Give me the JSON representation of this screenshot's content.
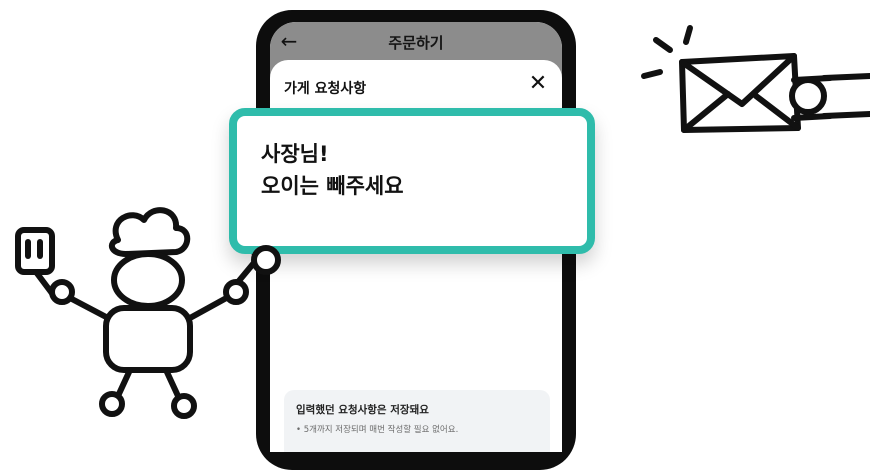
{
  "app_bar": {
    "back_icon": "arrow-left-icon",
    "title": "주문하기"
  },
  "sheet": {
    "title": "가게 요청사항",
    "close_icon": "close-icon"
  },
  "request": {
    "line1": "사장님!",
    "line2": "오이는 빼주세요"
  },
  "notice": {
    "title": "입력했던 요청사항은 저장돼요",
    "item": "• 5개까지 저장되며 매번 작성할 필요 없어요."
  },
  "colors": {
    "accent": "#2fbcab",
    "overlay": "#8c8c8c",
    "notice_bg": "#f1f3f5"
  }
}
